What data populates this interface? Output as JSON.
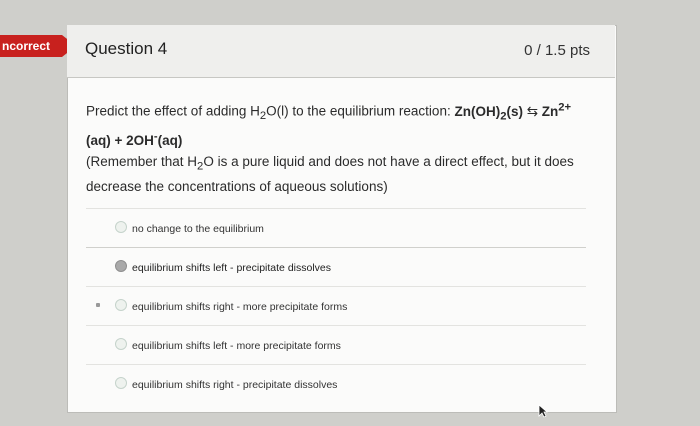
{
  "status_tag": {
    "label": "ncorrect"
  },
  "question": {
    "title": "Question 4",
    "points": "0 / 1.5 pts",
    "prompt_prefix": "Predict the effect of adding H",
    "prompt_h2o_sub": "2",
    "prompt_middle": "O(l) to the equilibrium reaction: ",
    "reaction_bold_1": "Zn(OH)",
    "reaction_sub": "2",
    "reaction_bold_2": "(s) ",
    "reaction_arrow": "⇆",
    "reaction_zn": " Zn",
    "reaction_zn_sup": "2+",
    "reaction_line2": "(aq)  +  2OH",
    "reaction_oh_sup": "-",
    "reaction_line2_end": "(aq)",
    "note_prefix": "(Remember that H",
    "note_sub": "2",
    "note_rest": "O is a pure liquid and does not have a direct effect, but it does decrease the concentrations of aqueous solutions)"
  },
  "answers": [
    {
      "label": "no change to the equilibrium",
      "selected": false
    },
    {
      "label": "equilibrium shifts left - precipitate dissolves",
      "selected": true
    },
    {
      "label": "equilibrium shifts right - more precipitate forms",
      "selected": false
    },
    {
      "label": "equilibrium shifts left - more precipitate forms",
      "selected": false
    },
    {
      "label": "equilibrium shifts right - precipitate dissolves",
      "selected": false
    }
  ],
  "colors": {
    "incorrect": "#c8211e"
  }
}
